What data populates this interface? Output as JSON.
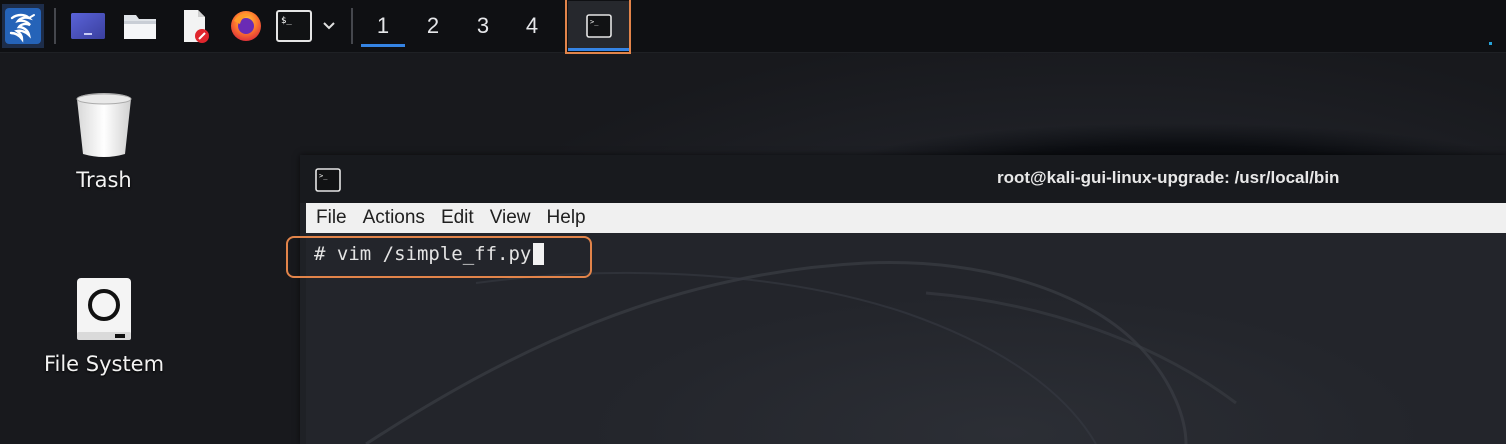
{
  "taskbar": {
    "apps": [
      {
        "name": "kali-menu",
        "icon": "kali-dragon-icon"
      },
      {
        "name": "show-desktop",
        "icon": "desktop-window-icon"
      },
      {
        "name": "file-manager",
        "icon": "folder-icon"
      },
      {
        "name": "text-editor",
        "icon": "text-file-icon"
      },
      {
        "name": "firefox",
        "icon": "firefox-icon"
      },
      {
        "name": "terminal",
        "icon": "terminal-icon"
      },
      {
        "name": "terminal-dropdown",
        "icon": "chevron-down-icon"
      }
    ],
    "workspaces": [
      "1",
      "2",
      "3",
      "4"
    ],
    "active_workspace": "1",
    "active_task": {
      "icon": "terminal-icon"
    }
  },
  "desktop": {
    "icons": [
      {
        "label": "Trash",
        "icon": "trash-icon"
      },
      {
        "label": "File System",
        "icon": "drive-icon"
      }
    ]
  },
  "terminal": {
    "title": "root@kali-gui-linux-upgrade: /usr/local/bin",
    "menu": [
      "File",
      "Actions",
      "Edit",
      "View",
      "Help"
    ],
    "prompt": "#",
    "command": "vim /simple_ff.py"
  },
  "colors": {
    "highlight": "#e2844a",
    "accent": "#3584e4"
  }
}
